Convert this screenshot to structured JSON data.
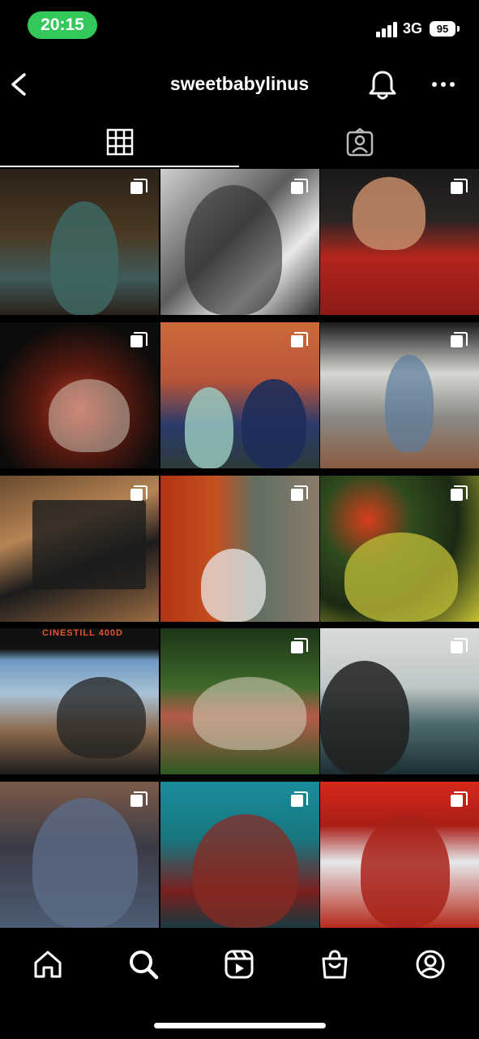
{
  "status_bar": {
    "time": "20:15",
    "network": "3G",
    "battery": "95"
  },
  "header": {
    "username": "sweetbabylinus"
  },
  "tabs": [
    {
      "name": "posts-grid",
      "icon": "grid-icon",
      "active": true
    },
    {
      "name": "tagged",
      "icon": "tagged-person-icon",
      "active": false
    }
  ],
  "grid": {
    "film_label": "CINESTILL 400D",
    "tiles": [
      {
        "multi": true
      },
      {
        "multi": true
      },
      {
        "multi": true
      },
      {
        "multi": true
      },
      {
        "multi": true
      },
      {
        "multi": true
      },
      {
        "multi": true
      },
      {
        "multi": true
      },
      {
        "multi": true
      },
      {
        "multi": false
      },
      {
        "multi": true
      },
      {
        "multi": true
      },
      {
        "multi": true
      },
      {
        "multi": true
      },
      {
        "multi": true
      }
    ]
  },
  "bottom_nav": [
    {
      "icon": "home-icon"
    },
    {
      "icon": "search-icon",
      "active": true
    },
    {
      "icon": "reels-icon"
    },
    {
      "icon": "shop-icon"
    },
    {
      "icon": "profile-icon"
    }
  ],
  "colors": {
    "background": "#000000",
    "time_pill": "#34c759",
    "film_text": "#e2552f"
  }
}
